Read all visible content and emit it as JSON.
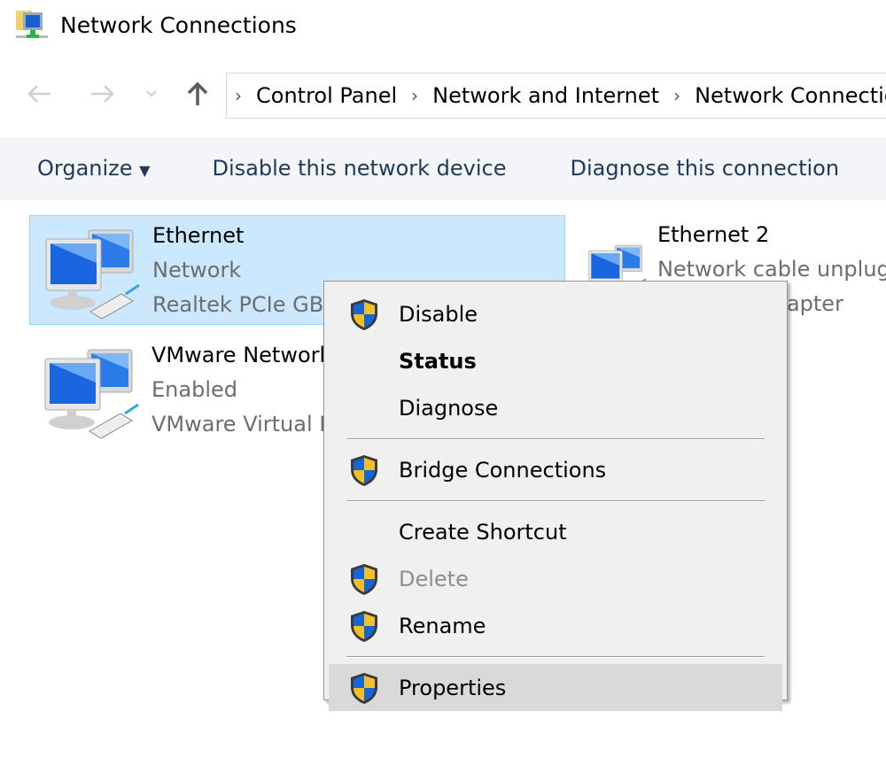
{
  "window": {
    "title": "Network Connections",
    "icon": "network-connections-icon"
  },
  "nav": {
    "back": "back-arrow-icon",
    "forward": "forward-arrow-icon",
    "recent": "chevron-down-icon",
    "up": "up-arrow-icon"
  },
  "breadcrumb": [
    "Control Panel",
    "Network and Internet",
    "Network Connections"
  ],
  "toolbar": {
    "organize": "Organize",
    "disable": "Disable this network device",
    "diagnose": "Diagnose this connection"
  },
  "connections": [
    {
      "name": "Ethernet",
      "status": "Network",
      "device": "Realtek PCIe GBE Family Controller",
      "selected": true
    },
    {
      "name": "Ethernet 2",
      "status": "Network cable unplugged",
      "device": "Windows Adapter"
    },
    {
      "name": "VMware Network Adapter",
      "status": "Enabled",
      "device": "VMware Virtual Ethernet Adapter"
    }
  ],
  "context_menu": {
    "disable": "Disable",
    "status": "Status",
    "diagnose": "Diagnose",
    "bridge": "Bridge Connections",
    "shortcut": "Create Shortcut",
    "delete": "Delete",
    "rename": "Rename",
    "properties": "Properties"
  },
  "colors": {
    "selection": "#cce8ff",
    "selection_border": "#99d1ff",
    "menu_bg": "#f0f0f0",
    "menu_highlight": "#d9d9d9",
    "toolbar_text": "#1e395b"
  }
}
